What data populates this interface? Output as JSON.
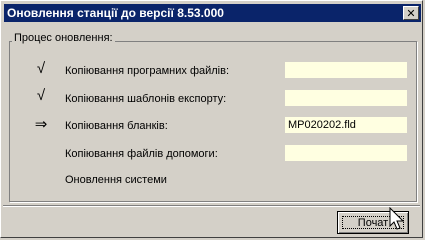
{
  "window": {
    "title": "Оновлення станції до версії 8.53.000",
    "close_label": "✕"
  },
  "group": {
    "label": "Процес оновлення:"
  },
  "steps": [
    {
      "mark": "√",
      "label": "Копіювання програмних файлів:",
      "value": ""
    },
    {
      "mark": "√",
      "label": "Копіювання шаблонів експорту:",
      "value": ""
    },
    {
      "mark": "⇒",
      "label": "Копіювання бланків:",
      "value": "MP020202.fld"
    },
    {
      "mark": "",
      "label": "Копіювання файлів допомоги:",
      "value": ""
    },
    {
      "mark": "",
      "label": "Оновлення системи",
      "value": null
    }
  ],
  "buttons": {
    "start_label": "Почат"
  },
  "icons": {
    "done": "checkmark-icon",
    "current": "arrow-right-icon",
    "cursor": "mouse-pointer-icon"
  },
  "colors": {
    "titlebar": "#0a246a",
    "field": "#ffffe1",
    "face": "#d4d0c8"
  }
}
